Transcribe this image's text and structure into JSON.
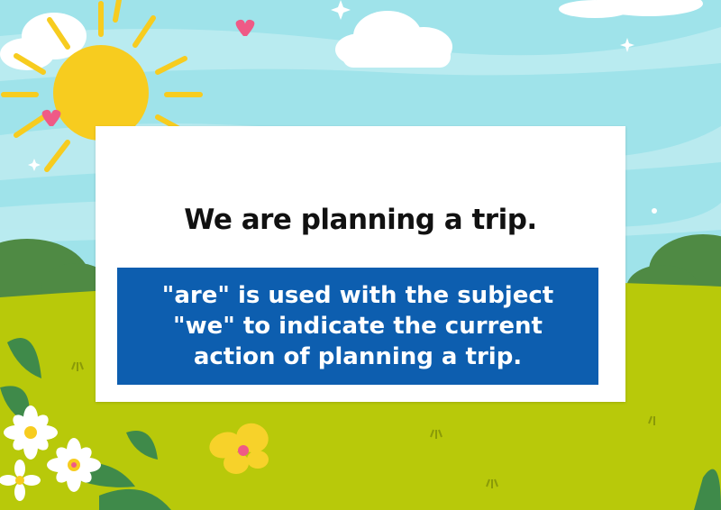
{
  "sentence": "We are planning a trip.",
  "explanation_lines": [
    "\"are\" is used with the subject",
    "\"we\" to indicate the current",
    "action of planning a trip."
  ],
  "colors": {
    "sky": "#9fe3ea",
    "grass": "#b8c90a",
    "sun": "#f7cc1f",
    "explanation_box": "#0d5eaf",
    "card": "#ffffff"
  },
  "decorations": [
    "sun-icon",
    "cloud-icon",
    "heart-icon",
    "sparkle-icon",
    "bush-icon",
    "daisy-icon",
    "butterfly-icon",
    "leaf-icon"
  ]
}
